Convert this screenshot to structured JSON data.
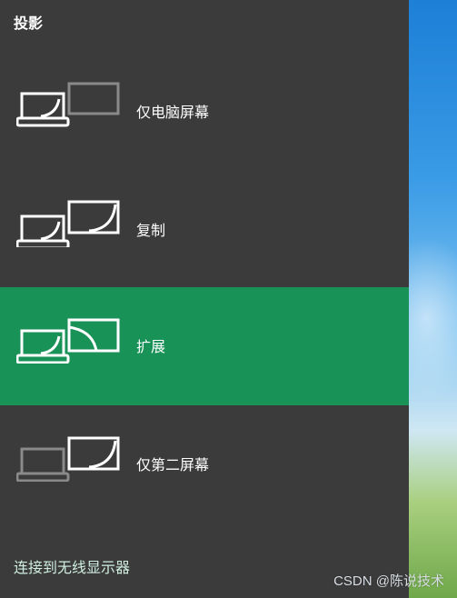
{
  "panel": {
    "title": "投影",
    "options": [
      {
        "label": "仅电脑屏幕",
        "icon": "pc-screen-only-icon"
      },
      {
        "label": "复制",
        "icon": "duplicate-screen-icon"
      },
      {
        "label": "扩展",
        "icon": "extend-screen-icon"
      },
      {
        "label": "仅第二屏幕",
        "icon": "second-screen-only-icon"
      }
    ],
    "selected_option": "扩展",
    "footer_link": "连接到无线显示器"
  },
  "watermark": "CSDN @陈说技术",
  "colors": {
    "panel_bg": "#3b3b3b",
    "selected_bg": "#189257",
    "text": "#ffffff",
    "dimmed_icon": "#8a8a8a"
  }
}
